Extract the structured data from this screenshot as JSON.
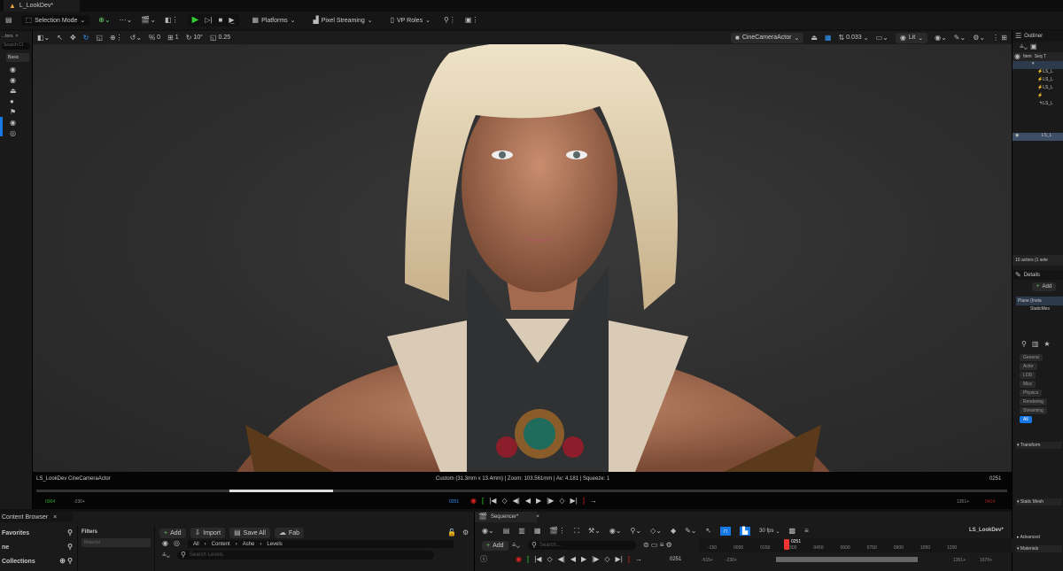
{
  "window": {
    "tab": "L_LookDev*"
  },
  "toolbar": {
    "mode": "Selection Mode",
    "platforms": "Platforms",
    "pixel_streaming": "Pixel Streaming",
    "vp_roles": "VP Roles"
  },
  "viewport_toolbar": {
    "snap_angle_value": "0",
    "scale_value": "1",
    "rotation_snap": "10°",
    "grid_snap": "0.25",
    "camera": "CineCameraActor",
    "speed": "0.033",
    "view_mode": "Lit"
  },
  "place_actors": {
    "tab": "...tors",
    "search": "Search Cl",
    "category": "Basic"
  },
  "viewport_overlay": {
    "left_label": "LS_LookDev  CineCameraActor",
    "center_info": "Custom (31.3mm x 13.4mm) | Zoom: 103.561mm | Av: 4.181 | Squeeze: 1",
    "frame_right": "0251",
    "start_frame": "0004",
    "view_start": "-230+",
    "current_frame": "0251",
    "view_end": "1351+",
    "end_frame": "0414"
  },
  "outliner": {
    "title": "Outliner",
    "col_item": "Item",
    "col_seq": "Seq T",
    "rows": [
      "LS_L",
      "LS_L",
      "LS_L",
      "",
      "LS_L",
      "LS_L"
    ],
    "footer": "10 actors (1 sele"
  },
  "details": {
    "title": "Details",
    "add": "Add",
    "selected": "Plane (Insta",
    "component": "StaticMes",
    "categories": [
      "General",
      "Actor",
      "LOD",
      "Misc",
      "Physics",
      "Rendering",
      "Streaming",
      "All"
    ],
    "sections": [
      "Transform",
      "Static Mesh",
      "Advanced",
      "Materials"
    ]
  },
  "content_browser": {
    "title": "Content Browser",
    "favorites": "Favorites",
    "project": "ne",
    "collections": "Collections",
    "filters": "Filters",
    "filter_chip": "Material",
    "add": "Add",
    "import": "Import",
    "save_all": "Save All",
    "fab": "Fab",
    "path": [
      "All",
      "Content",
      "Ashe",
      "Levels"
    ],
    "search_placeholder": "Search Levels"
  },
  "sequencer": {
    "title": "Sequencer*",
    "add": "Add",
    "search_placeholder": "Search...",
    "fps": "30 fps",
    "sequence_name": "LS_LookDev*",
    "current_frame": "0251",
    "playhead_label": "0251",
    "ticks": [
      "-150",
      "0000",
      "0150",
      "0300",
      "0450",
      "0600",
      "0750",
      "0900",
      "1050",
      "1200"
    ],
    "range_start": "-515+",
    "view_start": "-230+",
    "view_end": "1351+",
    "range_end": "1670+"
  }
}
